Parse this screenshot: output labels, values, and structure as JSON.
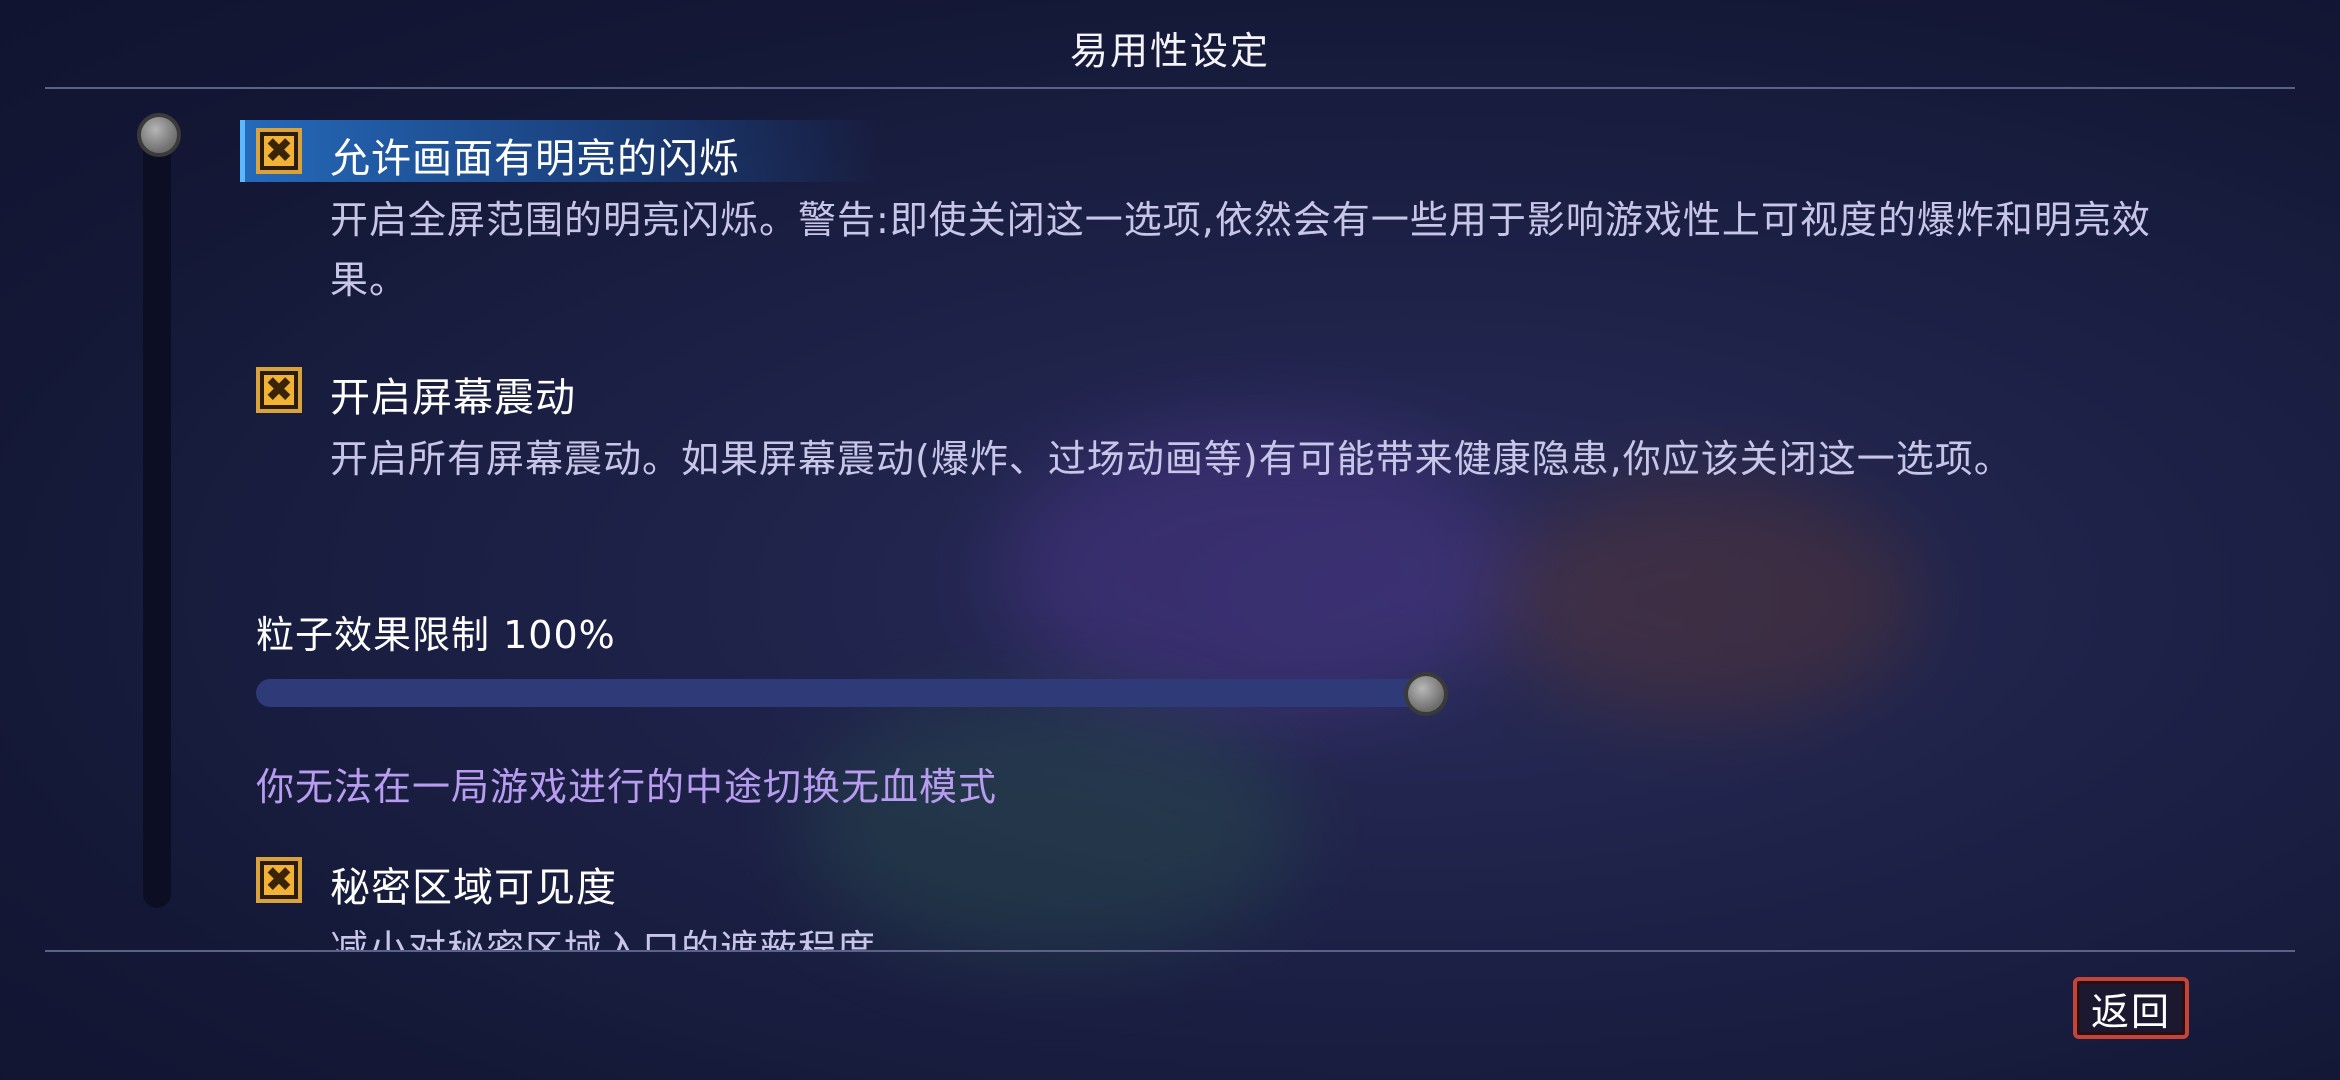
{
  "screen": {
    "title": "易用性设定"
  },
  "colors": {
    "checkbox": "#f2b233",
    "selected_highlight": "#2878d2",
    "warning_text": "#b89cf0",
    "slider_track": "#2f3a78",
    "back_button_border": "#c4443a"
  },
  "options": [
    {
      "label": "允许画面有明亮的闪烁",
      "checked": true,
      "selected": true,
      "description": "开启全屏范围的明亮闪烁。警告:即使关闭这一选项,依然会有一些用于影响游戏性上可视度的爆炸和明亮效果。"
    },
    {
      "label": "开启屏幕震动",
      "checked": true,
      "selected": false,
      "description": "开启所有屏幕震动。如果屏幕震动(爆炸、过场动画等)有可能带来健康隐患,你应该关闭这一选项。"
    },
    {
      "label": "秘密区域可见度",
      "checked": true,
      "selected": false,
      "description": "减小对秘密区域入口的遮蔽程度"
    }
  ],
  "slider": {
    "label": "粒子效果限制",
    "value_text": "100%",
    "value": 1.0
  },
  "notice": "你无法在一局游戏进行的中途切换无血模式",
  "checkbox_glyph": "✖",
  "footer": {
    "back_label": "返回"
  }
}
